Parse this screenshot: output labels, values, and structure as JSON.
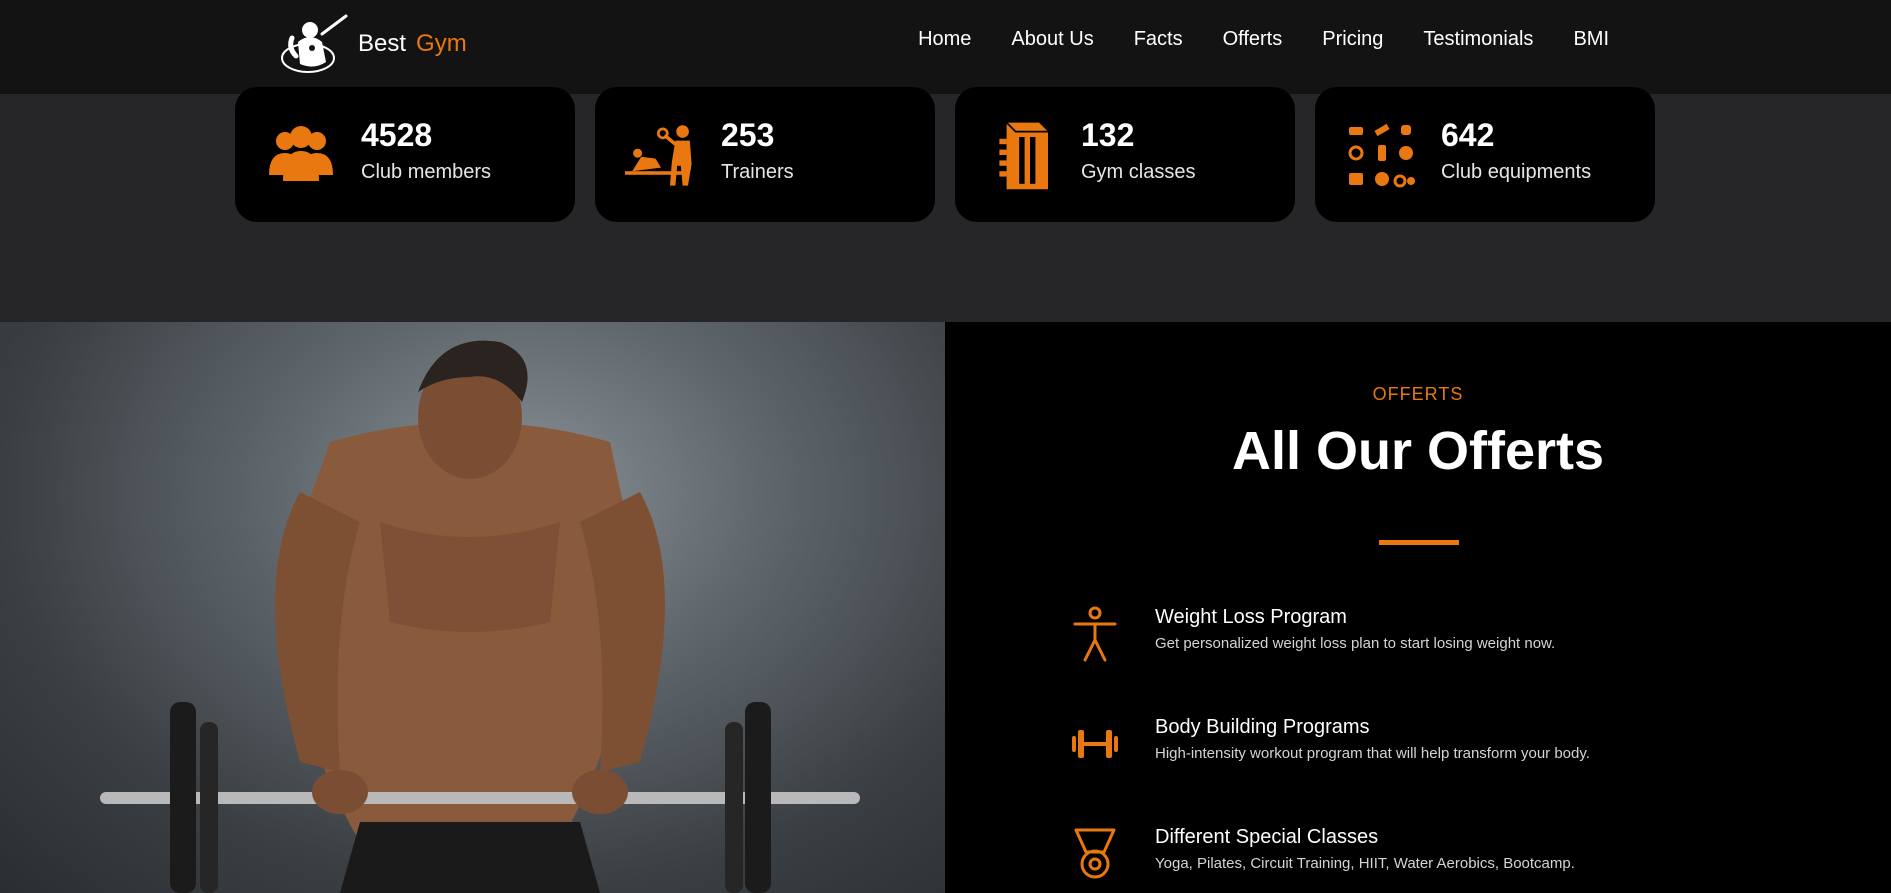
{
  "brand": {
    "word1": "Best",
    "word2": "Gym",
    "logo_icon": "gym-athlete-logo-icon"
  },
  "nav": {
    "items": [
      {
        "label": "Home"
      },
      {
        "label": "About Us"
      },
      {
        "label": "Facts"
      },
      {
        "label": "Offerts"
      },
      {
        "label": "Pricing"
      },
      {
        "label": "Testimonials"
      },
      {
        "label": "BMI"
      }
    ]
  },
  "stats": [
    {
      "value": "4528",
      "label": "Club members",
      "icon": "group-people-icon"
    },
    {
      "value": "253",
      "label": "Trainers",
      "icon": "trainer-icon"
    },
    {
      "value": "132",
      "label": "Gym classes",
      "icon": "building-icon"
    },
    {
      "value": "642",
      "label": "Club equipments",
      "icon": "equipment-grid-icon"
    }
  ],
  "offers": {
    "kicker": "OFFERTS",
    "title": "All Our Offerts",
    "items": [
      {
        "title": "Weight Loss Program",
        "description": "Get personalized weight loss plan to start losing weight now.",
        "icon": "person-standing-icon"
      },
      {
        "title": "Body Building Programs",
        "description": "High-intensity workout program that will help transform your body.",
        "icon": "dumbbell-icon"
      },
      {
        "title": "Different Special Classes",
        "description": "Yoga, Pilates, Circuit Training, HIIT, Water Aerobics, Bootcamp.",
        "icon": "medal-icon"
      }
    ]
  },
  "colors": {
    "accent": "#e8780f",
    "navbar_bg": "#131313",
    "page_bg": "#262628",
    "card_bg": "#000000"
  }
}
